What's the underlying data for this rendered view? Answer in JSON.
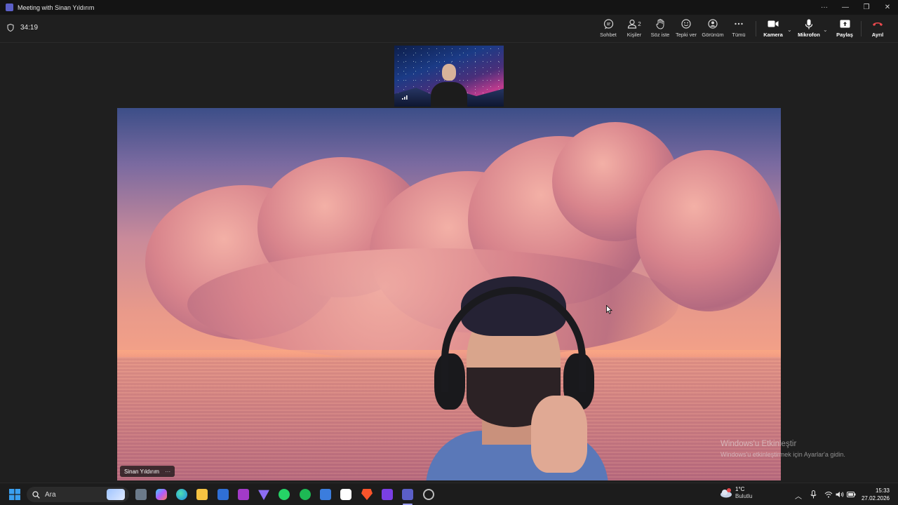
{
  "window": {
    "title": "Meeting with Sinan Yıldırım",
    "controls": {
      "more": "···",
      "minimize": "—",
      "restore": "❐",
      "close": "✕"
    }
  },
  "toolbar": {
    "timer": "34:19",
    "buttons": {
      "chat": "Sohbet",
      "people": "Kişiler",
      "people_count": "2",
      "raise_hand": "Söz iste",
      "react": "Tepki ver",
      "view": "Görünüm",
      "more": "Tümü",
      "camera": "Kamera",
      "mic": "Mikrofon",
      "share": "Paylaş",
      "leave": "Ayrıl"
    },
    "colors": {
      "leave": "#e5484d"
    }
  },
  "participant": {
    "name": "Sinan Yıldırım",
    "more": "···"
  },
  "watermark": {
    "line1": "Windows'u Etkinleştir",
    "line2": "Windows'u etkinleştirmek için Ayarlar'a gidin."
  },
  "taskbar": {
    "search_placeholder": "Ara",
    "weather_temp": "1°C",
    "weather_condition": "Bulutlu",
    "time": "15:33",
    "date": "27.02.2026"
  }
}
